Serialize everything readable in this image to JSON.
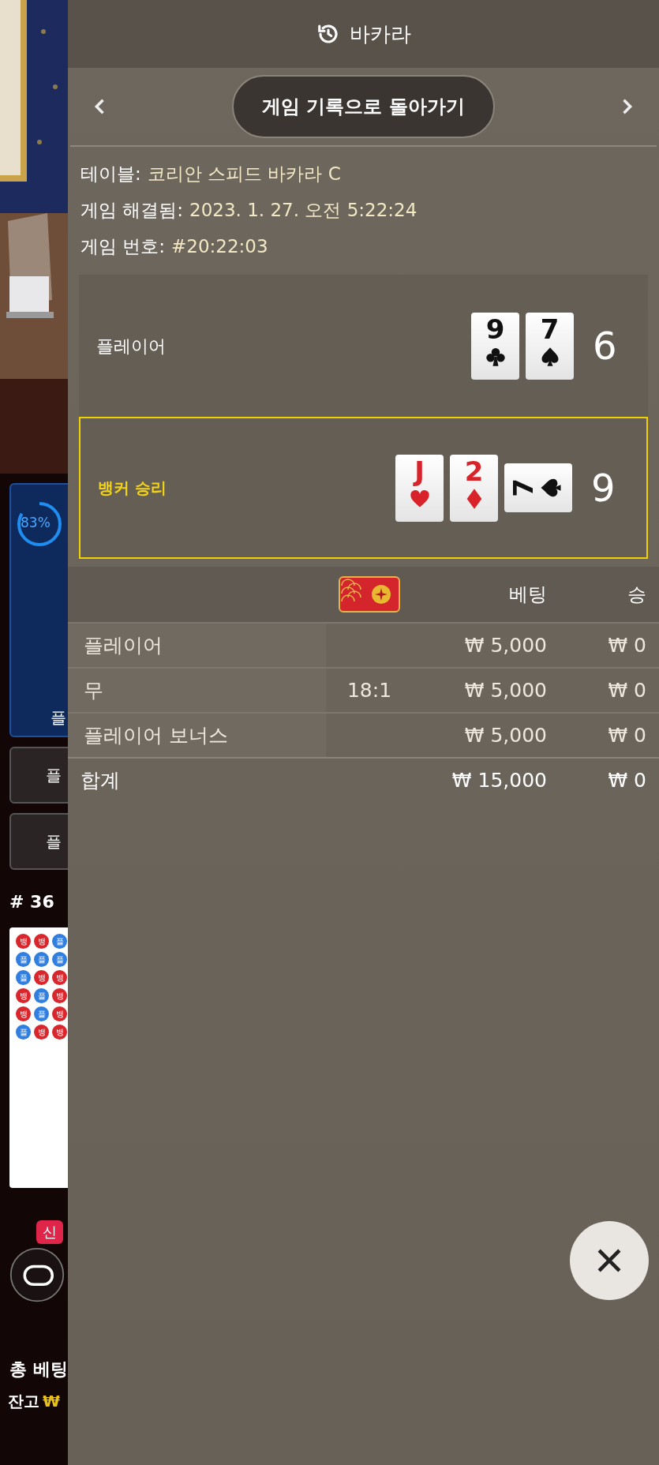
{
  "background": {
    "progress": {
      "reading": "83%",
      "level": 0.83
    },
    "bet_label": "플",
    "buttons": [
      "플",
      "플"
    ],
    "round": "# 36",
    "bead_road": [
      [
        {
          "kind": "banker",
          "label": "뱅"
        },
        {
          "kind": "banker",
          "label": "뱅"
        },
        {
          "kind": "player",
          "label": "플"
        }
      ],
      [
        {
          "kind": "player",
          "label": "플"
        },
        {
          "kind": "player",
          "label": "플"
        },
        {
          "kind": "player",
          "label": "플"
        }
      ],
      [
        {
          "kind": "player",
          "label": "플"
        },
        {
          "kind": "banker",
          "label": "뱅"
        },
        {
          "kind": "banker",
          "label": "뱅"
        }
      ],
      [
        {
          "kind": "banker",
          "label": "뱅"
        },
        {
          "kind": "player",
          "label": "플"
        },
        {
          "kind": "banker",
          "label": "뱅"
        }
      ],
      [
        {
          "kind": "banker",
          "label": "뱅"
        },
        {
          "kind": "player",
          "label": "플"
        },
        {
          "kind": "banker",
          "label": "뱅"
        }
      ],
      [
        {
          "kind": "player",
          "label": "플"
        },
        {
          "kind": "banker",
          "label": "뱅"
        },
        {
          "kind": "banker",
          "label": "뱅"
        }
      ]
    ],
    "new_badge": "신",
    "total_bet": "총 베팅",
    "balance_label": "잔고",
    "balance_currency": "₩"
  },
  "panel": {
    "title": "바카라",
    "back_button": "게임 기록으로 돌아가기",
    "info": [
      {
        "label": "테이블:",
        "value": "코리안 스피드 바카라 C"
      },
      {
        "label": "게임 해결됨:",
        "value": "2023. 1. 27. 오전 5:22:24"
      },
      {
        "label": "게임 번호:",
        "value": "#20:22:03"
      }
    ],
    "hands": [
      {
        "name": "플레이어",
        "winner": false,
        "score": "6",
        "cards": [
          {
            "rank": "9",
            "kind": "club",
            "sideways": false
          },
          {
            "rank": "7",
            "kind": "spade",
            "sideways": false
          }
        ]
      },
      {
        "name": "뱅커 승리",
        "winner": true,
        "score": "9",
        "cards": [
          {
            "rank": "J",
            "kind": "heart",
            "sideways": false
          },
          {
            "rank": "2",
            "kind": "diamond",
            "sideways": false
          },
          {
            "rank": "7",
            "kind": "spade",
            "sideways": true
          }
        ]
      }
    ],
    "bets": {
      "columns": [
        "베팅",
        "승"
      ],
      "rows": [
        {
          "name": "플레이어",
          "bet": "₩ 5,000",
          "win": "₩ 0"
        },
        {
          "name": "무",
          "odds": "18:1",
          "bet": "₩ 5,000",
          "win": "₩ 0"
        },
        {
          "name": "플레이어 보너스",
          "bet": "₩ 5,000",
          "win": "₩ 0"
        }
      ],
      "total": {
        "name": "합계",
        "bet": "₩ 15,000",
        "win": "₩ 0"
      }
    }
  }
}
